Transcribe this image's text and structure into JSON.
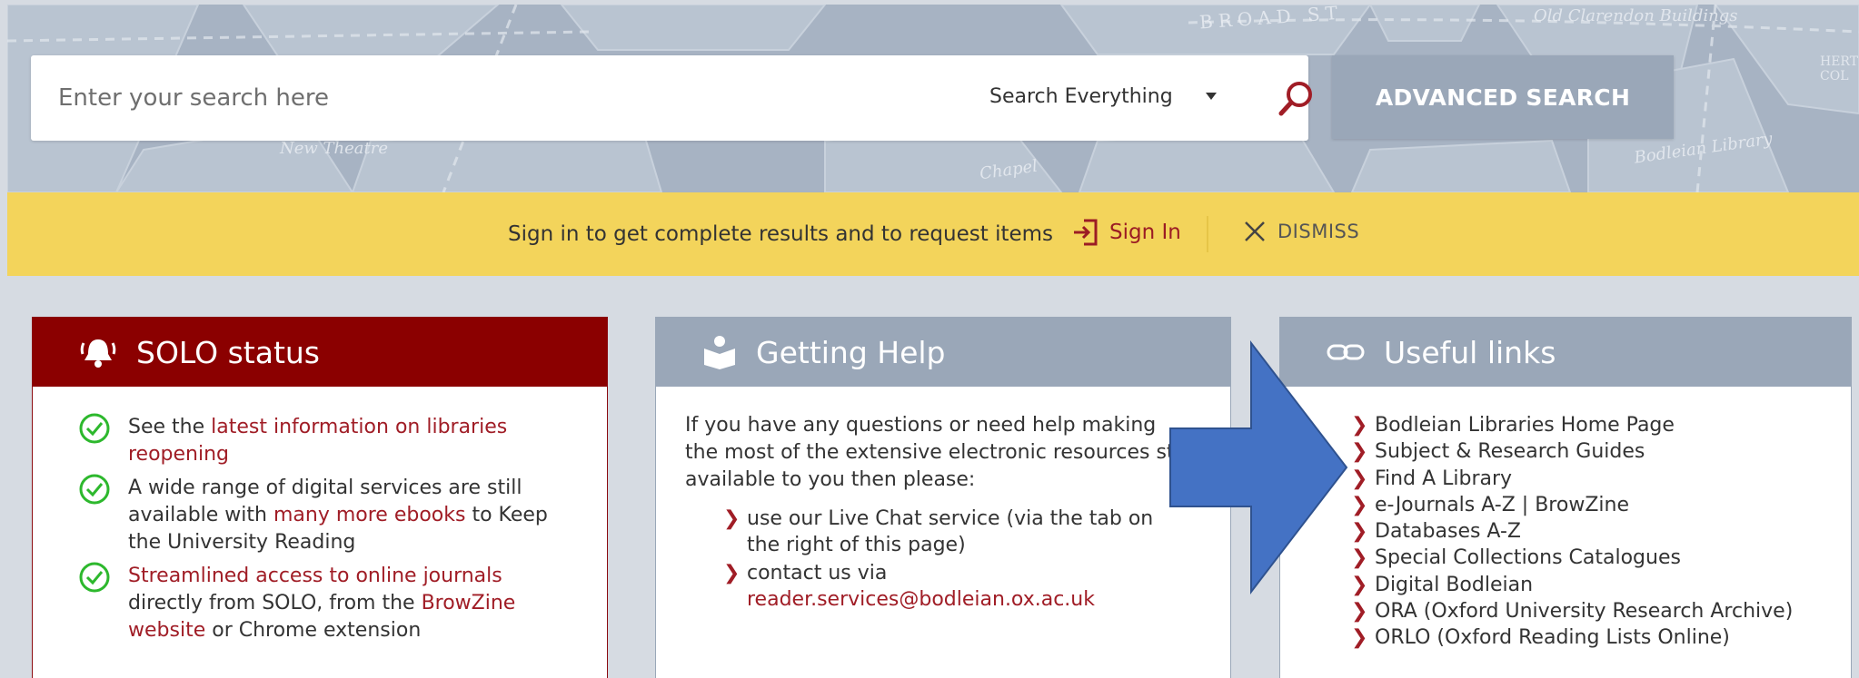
{
  "search": {
    "placeholder": "Enter your search here",
    "scope": "Search Everything",
    "advanced_label": "ADVANCED SEARCH"
  },
  "map_labels": [
    "BROAD ST",
    "Old Clarendon Buildings",
    "New Theatre",
    "Chapel",
    "Bodleian Library",
    "HERT COL"
  ],
  "signin_bar": {
    "message": "Sign in to get complete results and to request items",
    "signin_label": "Sign In",
    "dismiss_label": "DISMISS"
  },
  "solo_status": {
    "title": "SOLO status",
    "items": [
      {
        "pre": "See the ",
        "link": "latest information on libraries reopening",
        "post": ""
      },
      {
        "pre": "A wide range of digital services are still available with ",
        "link": "many more ebooks",
        "post": " to Keep the University Reading"
      },
      {
        "pre": "",
        "link": "Streamlined access to online journals",
        "mid": " directly from SOLO, from the ",
        "link2": "BrowZine website",
        "post": " or Chrome extension"
      }
    ]
  },
  "getting_help": {
    "title": "Getting Help",
    "intro": "If you have any questions or need help making the most of the extensive electronic resources still available to you then please:",
    "items": [
      {
        "text": "use our Live Chat service (via the tab on the right of this page)"
      },
      {
        "text": "contact us via",
        "link": "reader.services@bodleian.ox.ac.uk"
      }
    ]
  },
  "useful_links": {
    "title": "Useful links",
    "items": [
      "Bodleian Libraries Home Page",
      "Subject & Research Guides",
      "Find A Library",
      "e-Journals A-Z | BrowZine",
      "Databases A-Z",
      "Special Collections Catalogues",
      "Digital Bodleian",
      "ORA (Oxford University Research Archive)",
      "ORLO (Oxford Reading Lists Online)"
    ]
  },
  "colors": {
    "accent_red": "#8b0000",
    "link_red": "#a01d26",
    "signin_yellow": "#f3d45b",
    "panel_grey": "#9aa7b8",
    "check_green": "#2db82d",
    "arrow_blue": "#4472c4"
  }
}
